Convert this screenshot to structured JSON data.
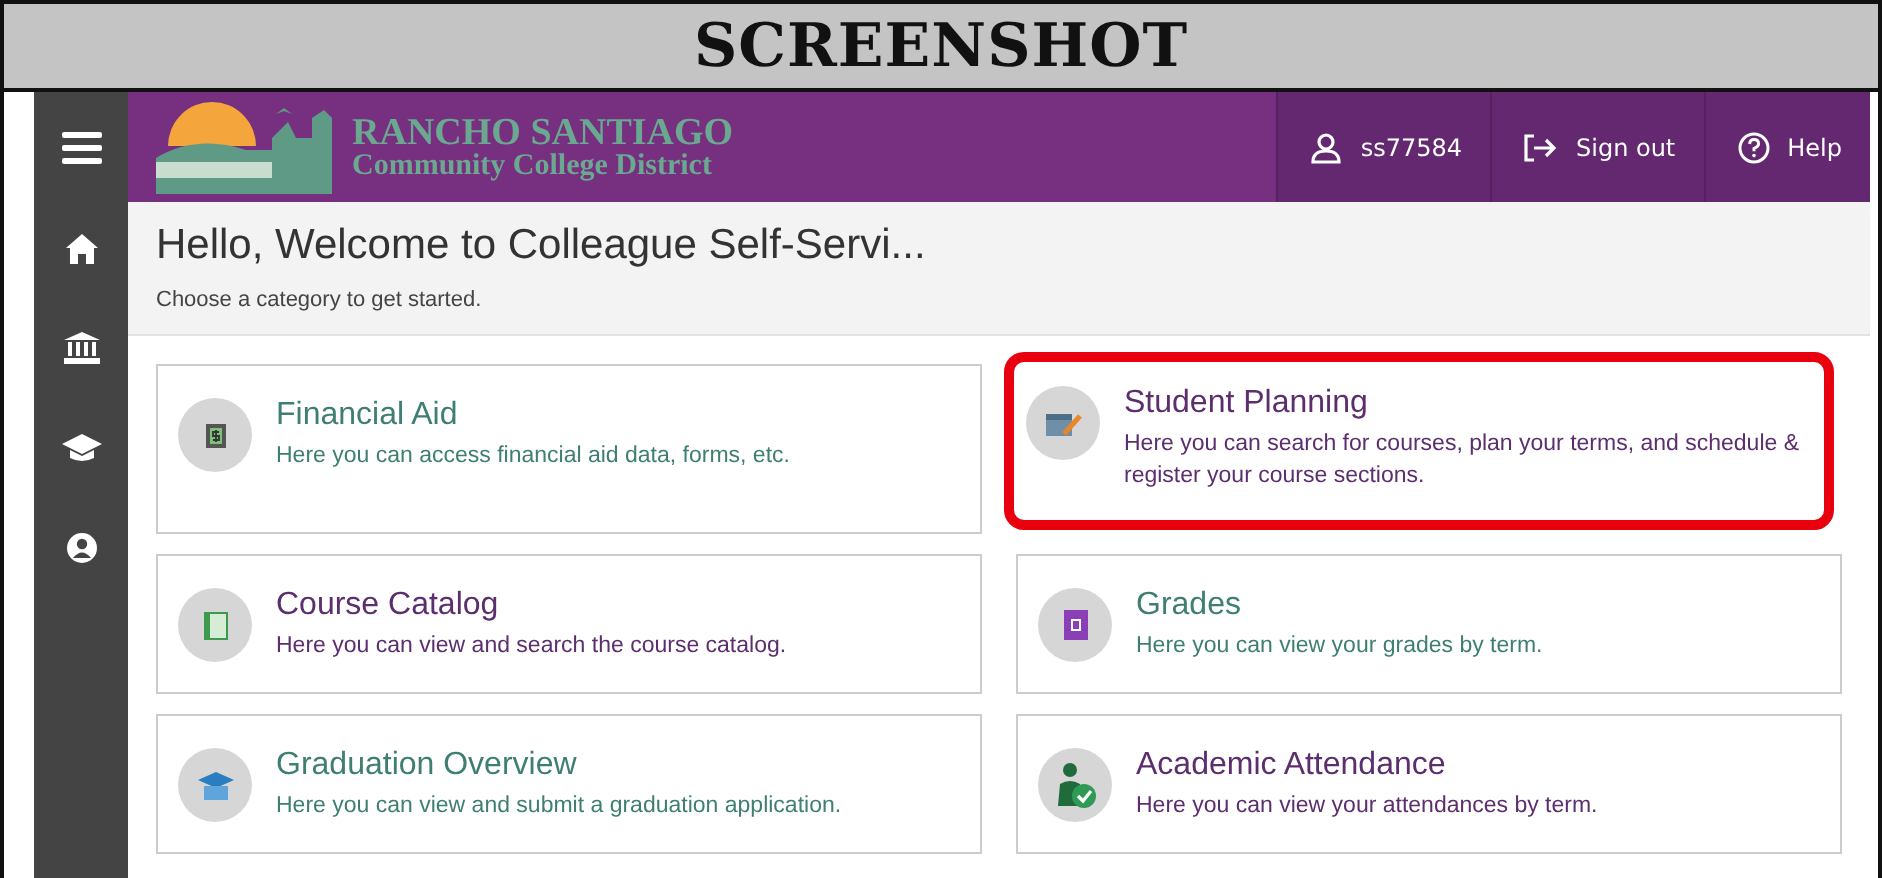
{
  "document_title": "SCREENSHOT",
  "sidebar": {
    "items": [
      {
        "kind": "menu"
      },
      {
        "kind": "home"
      },
      {
        "kind": "bank"
      },
      {
        "kind": "grad"
      },
      {
        "kind": "user"
      }
    ]
  },
  "header": {
    "logo": {
      "line1": "RANCHO SANTIAGO",
      "line2": "Community College District"
    },
    "user": "ss77584",
    "sign_out": "Sign out",
    "help": "Help"
  },
  "welcome": {
    "title": "Hello, Welcome to Colleague Self-Servi...",
    "subtitle": "Choose a category to get started."
  },
  "cards": [
    {
      "kind": "money",
      "title": "Financial Aid",
      "description": "Here you can access financial aid data, forms, etc.",
      "color": "#3f7f73",
      "highlighted": false
    },
    {
      "kind": "calendar",
      "title": "Student Planning",
      "description": "Here you can search for courses, plan your terms, and schedule & register your course sections.",
      "color": "#5c2e6e",
      "highlighted": true
    },
    {
      "kind": "book",
      "title": "Course Catalog",
      "description": "Here you can view and search the course catalog.",
      "color": "#5c2e6e",
      "highlighted": false
    },
    {
      "kind": "grade",
      "title": "Grades",
      "description": "Here you can view your grades by term.",
      "color": "#3f7f73",
      "highlighted": false
    },
    {
      "kind": "grad",
      "title": "Graduation Overview",
      "description": "Here you can view and submit a graduation application.",
      "color": "#3f7f73",
      "highlighted": false
    },
    {
      "kind": "attendance",
      "title": "Academic Attendance",
      "description": "Here you can view your attendances by term.",
      "color": "#5c2e6e",
      "highlighted": false
    }
  ]
}
